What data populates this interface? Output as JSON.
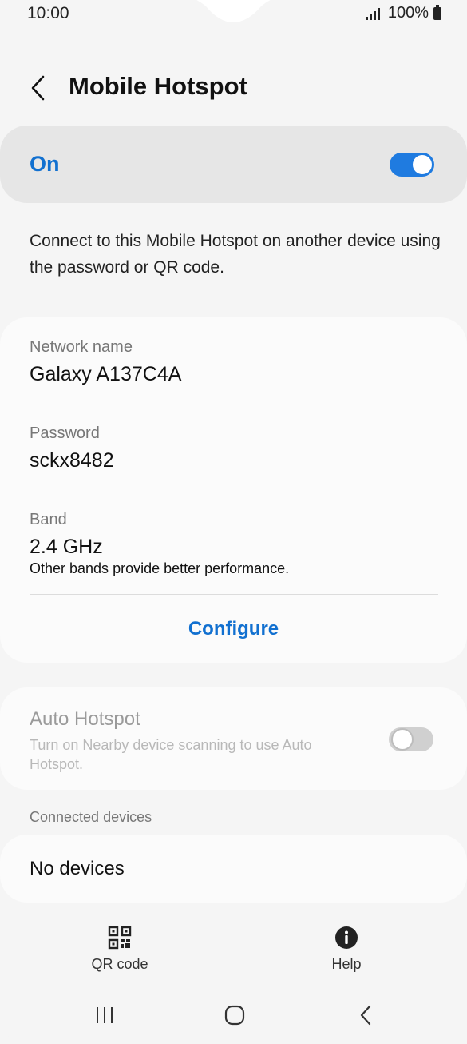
{
  "status_bar": {
    "time": "10:00",
    "battery": "100%"
  },
  "header": {
    "title": "Mobile Hotspot"
  },
  "master_switch": {
    "label": "On",
    "state": "on",
    "accent": "#1f7be0"
  },
  "description": "Connect to this Mobile Hotspot on another device using the password or QR code.",
  "network": {
    "name_label": "Network name",
    "name_value": "Galaxy A137C4A",
    "password_label": "Password",
    "password_value": "sckx8482",
    "band_label": "Band",
    "band_value": "2.4 GHz",
    "band_note": "Other bands provide better performance.",
    "configure_label": "Configure"
  },
  "auto_hotspot": {
    "title": "Auto Hotspot",
    "description": "Turn on Nearby device scanning to use Auto Hotspot.",
    "state": "off"
  },
  "connected_devices": {
    "section_label": "Connected devices",
    "empty_text": "No devices"
  },
  "actions": {
    "qr": {
      "label": "QR code",
      "icon": "qr-code-icon"
    },
    "help": {
      "label": "Help",
      "icon": "info-icon"
    }
  },
  "nav": {
    "recents": "recents-icon",
    "home": "home-icon",
    "back": "back-icon"
  }
}
